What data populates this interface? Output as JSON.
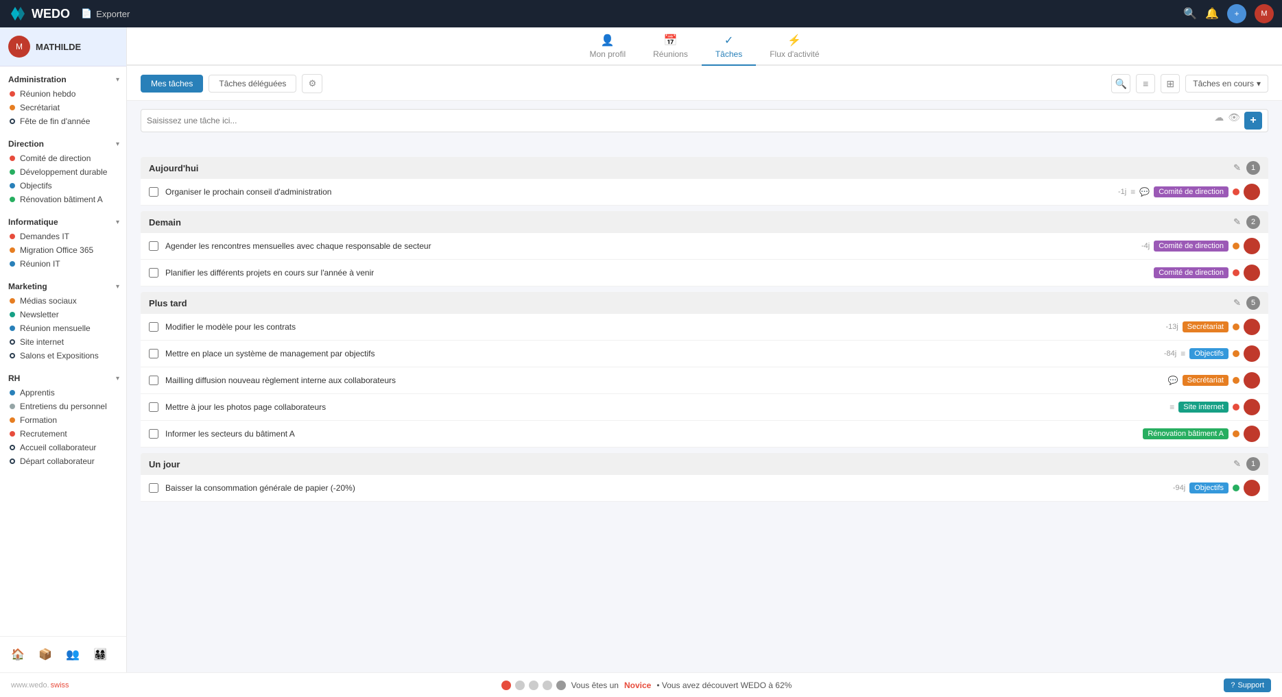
{
  "topbar": {
    "logo_text": "WEDO",
    "export_label": "Exporter"
  },
  "sidebar": {
    "username": "MATHILDE",
    "sections": [
      {
        "title": "Administration",
        "items": [
          {
            "label": "Réunion hebdo",
            "dot": "dot-red"
          },
          {
            "label": "Secrétariat",
            "dot": "dot-orange"
          },
          {
            "label": "Fête de fin d'année",
            "dot": "dot-outline-dark"
          }
        ]
      },
      {
        "title": "Direction",
        "items": [
          {
            "label": "Comité de direction",
            "dot": "dot-red"
          },
          {
            "label": "Développement durable",
            "dot": "dot-green"
          },
          {
            "label": "Objectifs",
            "dot": "dot-blue"
          },
          {
            "label": "Rénovation bâtiment A",
            "dot": "dot-green"
          }
        ]
      },
      {
        "title": "Informatique",
        "items": [
          {
            "label": "Demandes IT",
            "dot": "dot-red"
          },
          {
            "label": "Migration Office 365",
            "dot": "dot-orange"
          },
          {
            "label": "Réunion IT",
            "dot": "dot-blue"
          }
        ]
      },
      {
        "title": "Marketing",
        "items": [
          {
            "label": "Médias sociaux",
            "dot": "dot-orange"
          },
          {
            "label": "Newsletter",
            "dot": "dot-teal"
          },
          {
            "label": "Réunion mensuelle",
            "dot": "dot-blue"
          },
          {
            "label": "Site internet",
            "dot": "dot-outline-dark"
          },
          {
            "label": "Salons et Expositions",
            "dot": "dot-outline-dark"
          }
        ]
      },
      {
        "title": "RH",
        "items": [
          {
            "label": "Apprentis",
            "dot": "dot-blue"
          },
          {
            "label": "Entretiens du personnel",
            "dot": "dot-gray"
          },
          {
            "label": "Formation",
            "dot": "dot-orange"
          },
          {
            "label": "Recrutement",
            "dot": "dot-red"
          },
          {
            "label": "Accueil collaborateur",
            "dot": "dot-outline-dark"
          },
          {
            "label": "Départ collaborateur",
            "dot": "dot-outline-dark"
          }
        ]
      }
    ]
  },
  "nav_tabs": [
    {
      "id": "profil",
      "label": "Mon profil",
      "icon": "👤"
    },
    {
      "id": "reunions",
      "label": "Réunions",
      "icon": "📅"
    },
    {
      "id": "taches",
      "label": "Tâches",
      "icon": "✓",
      "active": true
    },
    {
      "id": "flux",
      "label": "Flux d'activité",
      "icon": "⚡"
    }
  ],
  "tasks": {
    "btn_mes_taches": "Mes tâches",
    "btn_delegue": "Tâches déléguées",
    "search_placeholder": "Saisissez une tâche ici...",
    "dropdown_label": "Tâches en cours",
    "sections": [
      {
        "id": "aujourd_hui",
        "title": "Aujourd'hui",
        "count": 1,
        "items": [
          {
            "text": "Organiser le prochain conseil d'administration",
            "days": "-1j",
            "icons": [
              "list",
              "comment"
            ],
            "tag": "Comité de direction",
            "tag_class": "tag-direction",
            "tag_dot_color": "#e74c3c"
          }
        ]
      },
      {
        "id": "demain",
        "title": "Demain",
        "count": 2,
        "items": [
          {
            "text": "Agender les rencontres mensuelles avec chaque responsable de secteur",
            "days": "-4j",
            "icons": [],
            "tag": "Comité de direction",
            "tag_class": "tag-direction",
            "tag_dot_color": "#e67e22"
          },
          {
            "text": "Planifier les différents projets en cours sur l'année à venir",
            "days": "",
            "icons": [],
            "tag": "Comité de direction",
            "tag_class": "tag-direction",
            "tag_dot_color": "#e74c3c"
          }
        ]
      },
      {
        "id": "plus_tard",
        "title": "Plus tard",
        "count": 5,
        "items": [
          {
            "text": "Modifier le modèle pour les contrats",
            "days": "-13j",
            "icons": [],
            "tag": "Secrétariat",
            "tag_class": "tag-secretariat",
            "tag_dot_color": "#e67e22"
          },
          {
            "text": "Mettre en place un système de management par objectifs",
            "days": "-84j",
            "icons": [
              "list"
            ],
            "tag": "Objectifs",
            "tag_class": "tag-objectifs",
            "tag_dot_color": "#e67e22"
          },
          {
            "text": "Mailling diffusion nouveau règlement interne aux collaborateurs",
            "days": "",
            "icons": [
              "comment"
            ],
            "tag": "Secrétariat",
            "tag_class": "tag-secretariat",
            "tag_dot_color": "#e67e22"
          },
          {
            "text": "Mettre à jour les photos page collaborateurs",
            "days": "",
            "icons": [
              "list"
            ],
            "tag": "Site internet",
            "tag_class": "tag-site",
            "tag_dot_color": "#e74c3c"
          },
          {
            "text": "Informer les secteurs du bâtiment A",
            "days": "",
            "icons": [],
            "tag": "Rénovation bâtiment A",
            "tag_class": "tag-renovation",
            "tag_dot_color": "#e67e22"
          }
        ]
      },
      {
        "id": "un_jour",
        "title": "Un jour",
        "count": 1,
        "items": [
          {
            "text": "Baisser la consommation générale de papier (-20%)",
            "days": "-94j",
            "icons": [],
            "tag": "Objectifs",
            "tag_class": "tag-objectifs",
            "tag_dot_color": "#27ae60"
          }
        ]
      }
    ]
  },
  "status_bar": {
    "left_text": "www.wedo.",
    "left_swiss": "swiss",
    "center_text": "Vous êtes un",
    "novice": "Novice",
    "center_text2": "• Vous avez découvert WEDO à 62%",
    "support": "Support"
  }
}
